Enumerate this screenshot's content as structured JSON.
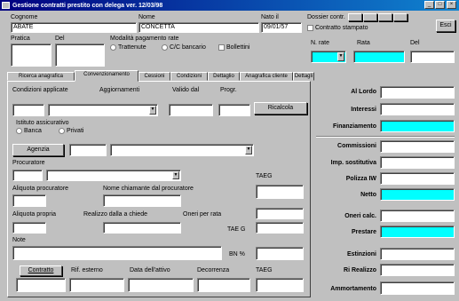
{
  "window": {
    "title": "Gestione contratti prestito con delega  ver. 12/03/98",
    "controls": [
      "_",
      "□",
      "×"
    ]
  },
  "header": {
    "cognome_label": "Cognome",
    "cognome_value": "ABATE",
    "nome_label": "Nome",
    "nome_value": "CONCETTA",
    "nato_label": "Nato il",
    "nato_value": "09/01/57",
    "dossier_label": "Dossier contr.",
    "contratto_stampato_label": "Contratto stampato",
    "esci_label": "Esci",
    "pratica_label": "Pratica",
    "del_label": "Del",
    "modalita_label": "Modalità pagamento rate",
    "trattenute_label": "Trattenute",
    "cc_label": "C/C bancario",
    "bollettini_label": "Bollettini",
    "n_rate_label": "N. rate",
    "rata_label": "Rata",
    "del2_label": "Del"
  },
  "tabs": [
    {
      "label": "Ricerca anagrafica",
      "active": false
    },
    {
      "label": "Convenzionamento",
      "active": true
    },
    {
      "label": "Cessioni",
      "active": false
    },
    {
      "label": "Condizioni",
      "active": false
    },
    {
      "label": "Dettaglio",
      "active": false
    },
    {
      "label": "Anagrafica cliente",
      "active": false
    },
    {
      "label": "Dettagli",
      "active": false
    }
  ],
  "panel": {
    "condizioni_label": "Condizioni applicate",
    "aggiornamenti_label": "Aggiornamenti",
    "valido_dal_label": "Valido dal",
    "progr_label": "Progr.",
    "ricalcola_label": "Ricalcola",
    "istituto_label": "Istituto assicurativo",
    "banca_label": "Banca",
    "privati_label": "Privati",
    "agenzia_label": "Agenzia",
    "procuratore_label": "Procuratore",
    "aliquota_procuratore_label": "Aliquota procuratore",
    "nome_chiamante_label": "Nome chiamante dal procuratore",
    "taeg_label": "TAEG",
    "aliquota_propria_label": "Aliquota propria",
    "realizzo_label": "Realizzo dalla a chiede",
    "oneri_label": "Oneri per rata",
    "taeg2_label": "TAE G",
    "note_label": "Note",
    "bn_label": "BN %",
    "contratto_label": "Contratto",
    "rif_esterno_label": "Rif. esterno",
    "data_attivo_label": "Data dell'attivo",
    "decorrenza_label": "Decorrenza",
    "taeg3_label": "TAEG"
  },
  "right": {
    "al_lordo": "Al Lordo",
    "interessi": "Interessi",
    "finanziamento": "Finanziamento",
    "commissioni": "Commissioni",
    "imp_sostitutiva": "Imp. sostitutiva",
    "polizza": "Polizza IW",
    "netto": "Netto",
    "oneri_calc": "Oneri calc.",
    "prestare": "Prestare",
    "estinzioni": "Estinzioni",
    "rif_realizzo": "Ri Realizzo",
    "ammortamento": "Ammortamento"
  },
  "colors": {
    "highlight": "#00ffff",
    "titlebar": "#000080"
  }
}
